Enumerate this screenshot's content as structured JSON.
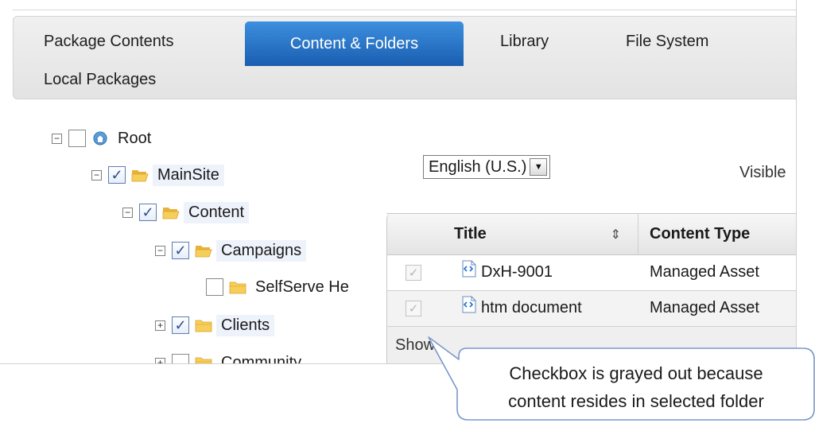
{
  "tabs": [
    {
      "label": "Package Contents",
      "active": false
    },
    {
      "label": "Content & Folders",
      "active": true
    },
    {
      "label": "Library",
      "active": false
    },
    {
      "label": "File System",
      "active": false
    },
    {
      "label": "Local Packages",
      "active": false
    }
  ],
  "tree": [
    {
      "label": "Root",
      "level": 0,
      "toggle": "minus",
      "checked": false,
      "icon": "root-site-icon"
    },
    {
      "label": "MainSite",
      "level": 1,
      "toggle": "minus",
      "checked": true,
      "icon": "folder-open-icon",
      "highlighted": true
    },
    {
      "label": "Content",
      "level": 2,
      "toggle": "minus",
      "checked": true,
      "icon": "folder-open-icon",
      "highlighted": true
    },
    {
      "label": "Campaigns",
      "level": 3,
      "toggle": "minus",
      "checked": true,
      "icon": "folder-open-icon",
      "highlighted": true
    },
    {
      "label": "SelfServe He",
      "level": 4,
      "toggle": "none",
      "checked": false,
      "icon": "folder-closed-icon"
    },
    {
      "label": "Clients",
      "level": 3,
      "toggle": "plus",
      "checked": true,
      "icon": "folder-closed-icon",
      "highlighted": true
    },
    {
      "label": "Community",
      "level": 3,
      "toggle": "plus",
      "checked": false,
      "icon": "folder-closed-icon"
    }
  ],
  "language": {
    "selected": "English (U.S.)"
  },
  "visible_label": "Visible",
  "grid": {
    "columns": [
      {
        "label": "Title",
        "sortable": true
      },
      {
        "label": "Content Type"
      }
    ],
    "sort_icon": "⇕",
    "rows": [
      {
        "title": "DxH-9001",
        "content_type": "Managed Asset",
        "checkbox_state": "disabled-checked"
      },
      {
        "title": "htm document",
        "content_type": "Managed Asset",
        "checkbox_state": "disabled-checked"
      }
    ],
    "footer_label": "Show"
  },
  "callout": {
    "line1": "Checkbox is grayed out because",
    "line2": "content resides in selected folder"
  },
  "colors": {
    "active_tab_top": "#3d8fdf",
    "active_tab_bottom": "#1a5eb0",
    "folder": "#f2c94c",
    "callout_border": "#7a98c9",
    "checkmark": "#2d4f8c"
  }
}
